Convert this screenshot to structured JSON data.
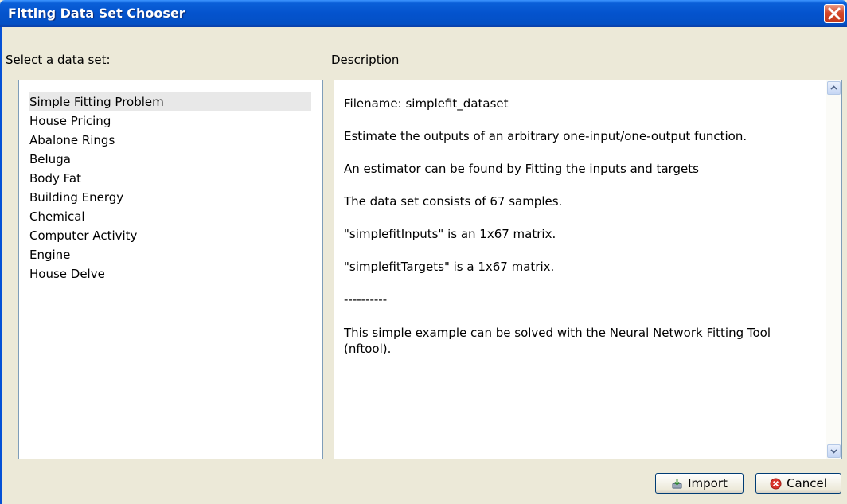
{
  "window": {
    "title": "Fitting Data Set Chooser"
  },
  "labels": {
    "select": "Select a data set:",
    "description": "Description"
  },
  "datasets": [
    "Simple Fitting Problem",
    "House Pricing",
    "Abalone Rings",
    "Beluga",
    "Body Fat",
    "Building Energy",
    "Chemical",
    "Computer Activity",
    "Engine",
    "House Delve"
  ],
  "selected_dataset": "Simple Fitting Problem",
  "description": {
    "filename": "Filename: simplefit_dataset",
    "line1": "Estimate the outputs of an arbitrary one-input/one-output function.",
    "line2": "An estimator can be found by Fitting the inputs and targets",
    "line3": "The data set consists of 67 samples.",
    "line4": "\"simplefitInputs\" is an 1x67 matrix.",
    "line5": "\"simplefitTargets\" is a 1x67 matrix.",
    "separator": "----------",
    "line6": "This simple example can be solved with the Neural Network Fitting Tool (nftool)."
  },
  "buttons": {
    "import": "Import",
    "cancel": "Cancel"
  },
  "icons": {
    "close": "close-icon",
    "import": "import-icon",
    "cancel": "cancel-icon"
  }
}
